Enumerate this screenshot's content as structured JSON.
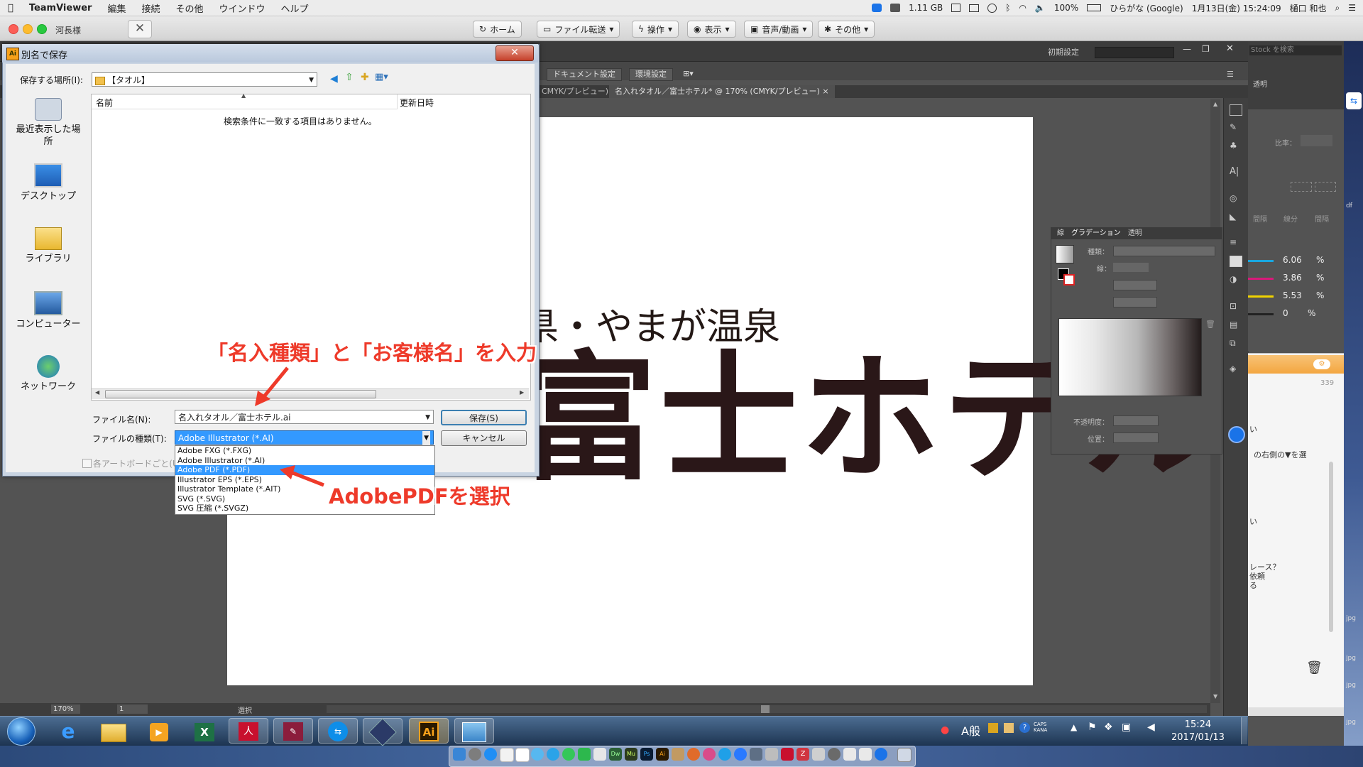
{
  "mac_menubar": {
    "app": "TeamViewer",
    "items": [
      "編集",
      "接続",
      "その他",
      "ウインドウ",
      "ヘルプ"
    ],
    "memory": "1.11 GB",
    "battery": "100%",
    "input_method": "ひらがな (Google)",
    "datetime": "1月13日(金) 15:24:09",
    "user": "樋口 和也"
  },
  "teamviewer": {
    "window_title": "河長様",
    "buttons": [
      "ホーム",
      "ファイル転送",
      "操作",
      "表示",
      "音声/動画",
      "その他"
    ]
  },
  "illustrator": {
    "workspace": "初期設定",
    "control_buttons": [
      "ドキュメント設定",
      "環境設定"
    ],
    "tabs": [
      "CMYK/プレビュー)",
      "名入れタオル／富士ホテル* @ 170% (CMYK/プレビュー)"
    ],
    "artwork_line1": "県・やまが温泉",
    "artwork_line2": "富士ホテル",
    "zoom": "170%",
    "page": "1",
    "status": "選択",
    "stock_search": "Stock を検索"
  },
  "gradient_panel": {
    "tabs": [
      "線",
      "グラデーション",
      "透明"
    ],
    "type_label": "種類：",
    "stroke_label": "線：",
    "opacity_label": "不透明度：",
    "position_label": "位置："
  },
  "right_panel": {
    "transparency_tab": "透明",
    "ratio_label": "比率：",
    "spacing_labels": [
      "間隔",
      "線分",
      "間隔"
    ],
    "cmyk": [
      {
        "value": "6.06",
        "unit": "%",
        "color": "#19a7e0"
      },
      {
        "value": "3.86",
        "unit": "%",
        "color": "#d9197a"
      },
      {
        "value": "5.53",
        "unit": "%",
        "color": "#f0d300"
      },
      {
        "value": "0",
        "unit": "%",
        "color": "#222222"
      }
    ],
    "counter": "339",
    "texts": [
      "い",
      "の右側の▼を選",
      "い",
      "レース？",
      "依頼",
      "る"
    ],
    "jpg_labels": [
      "jpg",
      "jpg",
      "jpg",
      "jpg"
    ],
    "df_label": "df"
  },
  "dialog": {
    "title": "別名で保存",
    "save_in_label": "保存する場所(I):",
    "save_in_value": "【タオル】",
    "sidebar": [
      "最近表示した場所",
      "デスクトップ",
      "ライブラリ",
      "コンピューター",
      "ネットワーク"
    ],
    "col_name": "名前",
    "col_date": "更新日時",
    "empty_message": "検索条件に一致する項目はありません。",
    "filename_label": "ファイル名(N):",
    "filename_value": "名入れタオル／富士ホテル.ai",
    "filetype_label": "ファイルの種類(T):",
    "filetype_value": "Adobe Illustrator (*.AI)",
    "save_button": "保存(S)",
    "cancel_button": "キャンセル",
    "artboard_checkbox": "各アートボードごと(U)",
    "filetype_options": [
      {
        "label": "Adobe FXG (*.FXG)",
        "selected": false
      },
      {
        "label": "Adobe Illustrator (*.AI)",
        "selected": false
      },
      {
        "label": "Adobe PDF (*.PDF)",
        "selected": true
      },
      {
        "label": "Illustrator EPS (*.EPS)",
        "selected": false
      },
      {
        "label": "Illustrator Template (*.AIT)",
        "selected": false
      },
      {
        "label": "SVG (*.SVG)",
        "selected": false
      },
      {
        "label": "SVG 圧縮 (*.SVGZ)",
        "selected": false
      }
    ]
  },
  "annotations": {
    "top": "「名入種類」と「お客様名」を入力",
    "bottom": "AdobePDFを選択"
  },
  "taskbar": {
    "time": "15:24",
    "date": "2017/01/13",
    "ime": "A般"
  }
}
